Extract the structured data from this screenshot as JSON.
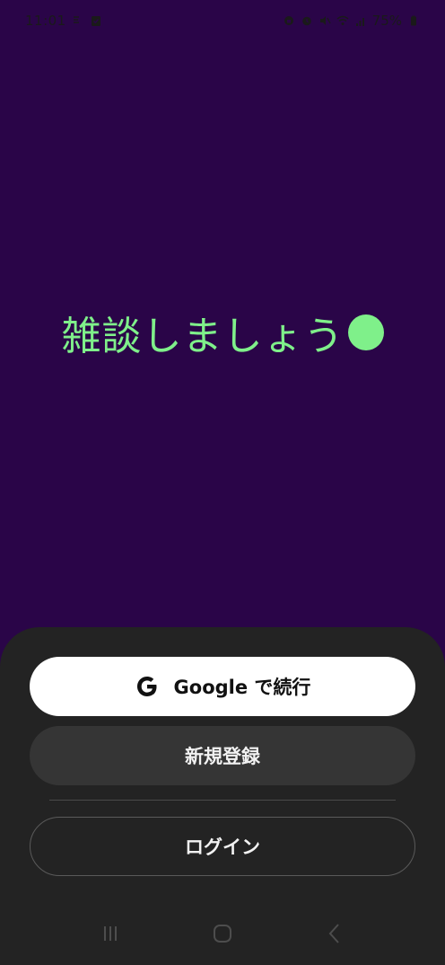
{
  "status_bar": {
    "time": "11:01",
    "battery": "75%"
  },
  "hero": {
    "text": "雑談しましょう"
  },
  "actions": {
    "google_label": "Google で続行",
    "register_label": "新規登録",
    "login_label": "ログイン"
  },
  "colors": {
    "background": "#2a0548",
    "accent": "#7ff08a",
    "sheet": "#232323"
  },
  "icons": {
    "google": "google-g-icon",
    "nav_recents": "recents-icon",
    "nav_home": "home-icon",
    "nav_back": "back-icon"
  }
}
